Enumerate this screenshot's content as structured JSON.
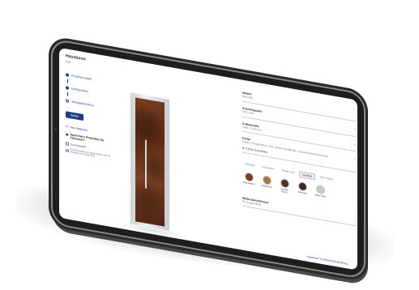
{
  "app": {
    "title": "Haustüren",
    "subtitle": "Tür"
  },
  "stepper": {
    "steps": [
      {
        "label": "Produktauswahl"
      },
      {
        "label": "Konfiguration"
      },
      {
        "label": "Anfrageabschluss"
      }
    ]
  },
  "actions": {
    "primary_label": "Weiter",
    "secondary_link": "Neu beginnen",
    "save_text": "Speichern Produkte für Zuhause?",
    "confirm_label": "Zur Auswahl",
    "fine_print": "Ihre Auswahl wird gespeichert und im Angebot berücksichtigt"
  },
  "panel": {
    "fields": [
      {
        "label": "Modell",
        "value": "Maxi 460"
      },
      {
        "label": "Anschlagseite",
        "value": "DIN Links"
      },
      {
        "label": "Außenmaße",
        "value": "1050 x 2100 mm"
      },
      {
        "label": "Farbe",
        "value": "Außen: Rostig-Patina, Holz, Metall-Oberflächen. Standard-Innenseite Weiß"
      }
    ],
    "info_link": "Farbe auswählen",
    "tabs": [
      "Standard",
      "Holzoptiken",
      "Metall-Look",
      "Rostlook",
      "RAL-Farben"
    ],
    "active_tab": 3,
    "swatches": [
      {
        "label": "Rost-Patina",
        "color": "#7a3f22"
      },
      {
        "label": "Goldeiche",
        "color": "#a8733f"
      },
      {
        "label": "Dunkle Eiche",
        "color": "#4e3426"
      },
      {
        "label": "Walnuss",
        "color": "#3d2a22"
      },
      {
        "label": "Silber matt",
        "color": "#c6c8cb"
      }
    ],
    "resistance": {
      "label": "Widerstandsklasse",
      "value": "RC 2 (Standard)"
    }
  },
  "footer": {
    "link": "Impressum & Datenschutzerklärung"
  },
  "colors": {
    "accent": "#1c3d8c",
    "door": "#6b3419",
    "bezel": "#1e1e20"
  }
}
